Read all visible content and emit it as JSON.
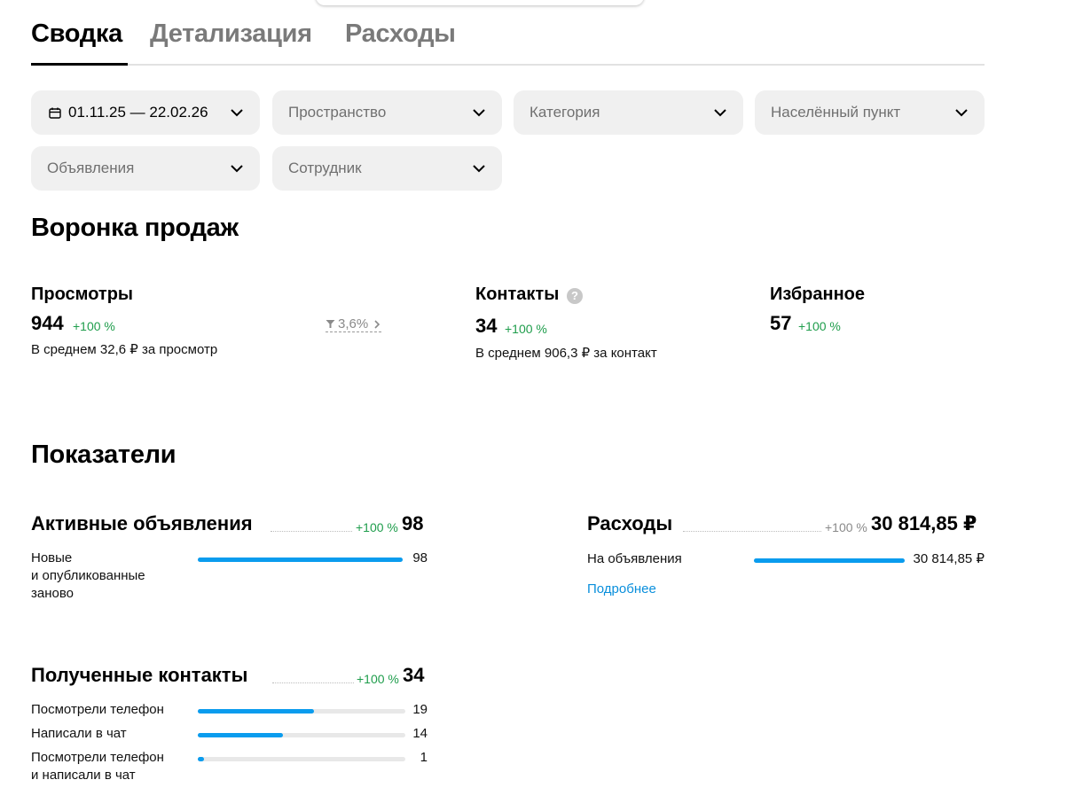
{
  "tabs": [
    {
      "label": "Сводка",
      "active": true
    },
    {
      "label": "Детализация",
      "active": false
    },
    {
      "label": "Расходы",
      "active": false
    }
  ],
  "filters": {
    "date_range": "01.11.25 — 22.02.26",
    "space": "Пространство",
    "category": "Категория",
    "locality": "Населённый пункт",
    "listings": "Объявления",
    "employee": "Сотрудник"
  },
  "funnel": {
    "title": "Воронка продаж",
    "views": {
      "title": "Просмотры",
      "value": "944",
      "delta": "+100 %",
      "avg": "В среднем 32,6 ₽ за просмотр",
      "conversion": "3,6%"
    },
    "contacts": {
      "title": "Контакты",
      "help": "?",
      "value": "34",
      "delta": "+100 %",
      "avg": "В среднем 906,3 ₽ за контакт"
    },
    "favorites": {
      "title": "Избранное",
      "value": "57",
      "delta": "+100 %"
    }
  },
  "indicators": {
    "title": "Показатели",
    "active_listings": {
      "title": "Активные объявления",
      "delta": "+100 %",
      "total": "98",
      "rows": [
        {
          "label": "Новые\nи опубликованные\nзаново",
          "value": "98",
          "fraction": 1.0
        }
      ]
    },
    "expenses": {
      "title": "Расходы",
      "delta": "+100 %",
      "total": "30 814,85 ₽",
      "rows": [
        {
          "label": "На объявления",
          "value": "30 814,85 ₽",
          "fraction": 1.0
        }
      ],
      "more_link": "Подробнее"
    },
    "received_contacts": {
      "title": "Полученные контакты",
      "delta": "+100 %",
      "total": "34",
      "rows": [
        {
          "label": "Посмотрели телефон",
          "value": "19",
          "fraction": 0.56
        },
        {
          "label": "Написали в чат",
          "value": "14",
          "fraction": 0.41
        },
        {
          "label": "Посмотрели телефон\nи написали в чат",
          "value": "1",
          "fraction": 0.03
        }
      ]
    }
  },
  "colors": {
    "accent": "#0a9cee",
    "positive": "#1f9d4c",
    "muted": "#7a7a7a",
    "filter_bg": "#f0f0f0"
  }
}
